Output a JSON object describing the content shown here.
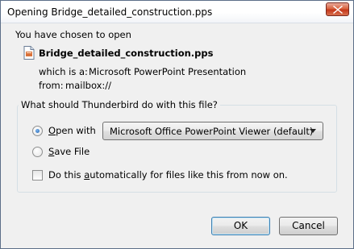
{
  "window": {
    "title": "Opening Bridge_detailed_construction.pps"
  },
  "intro": "You have chosen to open",
  "file": {
    "name": "Bridge_detailed_construction.pps",
    "which_is_label": "which is a:",
    "type": "Microsoft PowerPoint Presentation",
    "from_label": "from:",
    "source": "mailbox://"
  },
  "question": "What should Thunderbird do with this file?",
  "options": {
    "open_with_first": "O",
    "open_with_rest": "pen with",
    "open_with_app": "Microsoft Office PowerPoint Viewer (default)",
    "open_with_selected": true,
    "save_first": "S",
    "save_rest": "ave File",
    "auto_pre": "Do this ",
    "auto_key": "a",
    "auto_post": "utomatically for files like this from now on.",
    "auto_checked": false
  },
  "buttons": {
    "ok": "OK",
    "cancel": "Cancel"
  },
  "colors": {
    "close_button": "#c4371a",
    "radio_dot": "#1c5fb0",
    "default_button_border": "#3c7fb1"
  },
  "icons": [
    "close-icon",
    "document-icon",
    "dropdown-arrow-icon"
  ]
}
